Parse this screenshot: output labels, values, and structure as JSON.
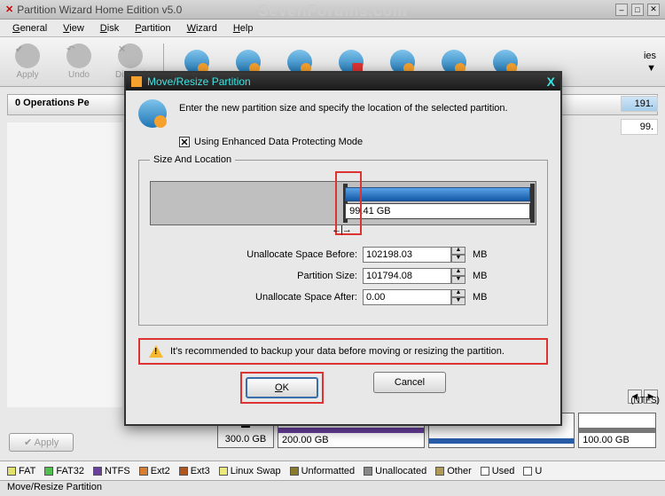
{
  "window": {
    "title": "Partition Wizard Home Edition v5.0"
  },
  "watermark": "SevenForums.com",
  "menu": {
    "general": "General",
    "view": "View",
    "disk": "Disk",
    "partition": "Partition",
    "wizard": "Wizard",
    "help": "Help"
  },
  "toolbar": {
    "apply": "Apply",
    "undo": "Undo",
    "discard": "Discard",
    "b1": "",
    "b2": "",
    "b3": "",
    "b4": "",
    "b5": "",
    "b6": "",
    "b7": "",
    "ies": "ies",
    "down": "▼"
  },
  "ops": {
    "pending": "0 Operations Pe"
  },
  "right": {
    "size1": "191.",
    "size2": "99."
  },
  "apply_btn": "Apply",
  "ntfs_hint": "(NTFS)",
  "disks": {
    "d1": "300.0 GB",
    "d2": "200.00 GB",
    "d3": "",
    "d4": "100.00 GB"
  },
  "legend": {
    "fat": "FAT",
    "fat32": "FAT32",
    "ntfs": "NTFS",
    "ext2": "Ext2",
    "ext3": "Ext3",
    "swap": "Linux Swap",
    "unformatted": "Unformatted",
    "unallocated": "Unallocated",
    "other": "Other",
    "used": "Used",
    "u": "U"
  },
  "status": "Move/Resize Partition",
  "dialog": {
    "title": "Move/Resize Partition",
    "intro": "Enter the new partition size and specify the location of the selected partition.",
    "checkbox": "Using Enhanced Data Protecting Mode",
    "group": "Size And Location",
    "partsize_visual": "99.41 GB",
    "lbl_before": "Unallocate Space Before:",
    "val_before": "102198.03",
    "lbl_size": "Partition Size:",
    "val_size": "101794.08",
    "lbl_after": "Unallocate Space After:",
    "val_after": "0.00",
    "unit": "MB",
    "warning": "It's recommended to backup your data before moving or resizing the partition.",
    "ok": "OK",
    "cancel": "Cancel"
  }
}
